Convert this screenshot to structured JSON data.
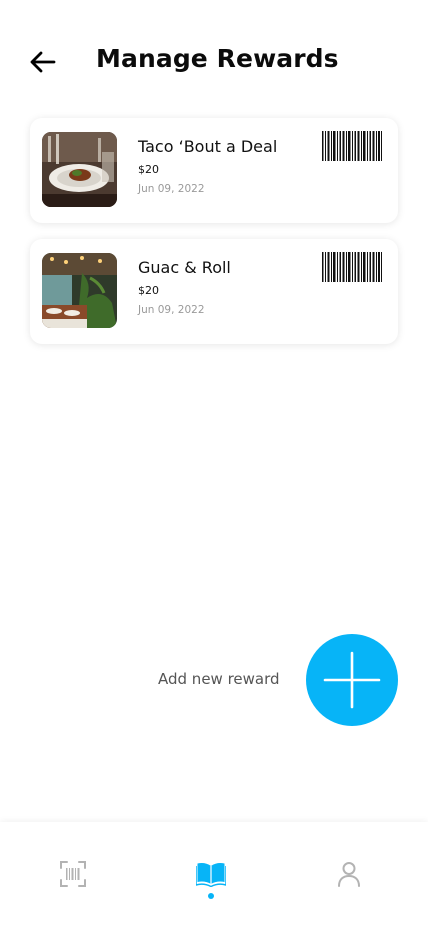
{
  "header": {
    "title": "Manage Rewards",
    "back_icon": "arrow-left-icon"
  },
  "rewards": [
    {
      "title": "Taco ‘Bout a Deal",
      "price": "$20",
      "date": "Jun 09, 2022",
      "image_icon": "restaurant-photo",
      "barcode_icon": "barcode-icon"
    },
    {
      "title": "Guac & Roll",
      "price": "$20",
      "date": "Jun 09, 2022",
      "image_icon": "restaurant-photo",
      "barcode_icon": "barcode-icon"
    }
  ],
  "add_reward": {
    "label": "Add new reward",
    "icon": "plus-icon",
    "color": "#07b4f7"
  },
  "bottom_nav": {
    "items": [
      {
        "icon": "barcode-scan-icon",
        "active": false
      },
      {
        "icon": "open-book-icon",
        "active": true
      },
      {
        "icon": "user-icon",
        "active": false
      }
    ],
    "accent": "#07b4f7"
  }
}
